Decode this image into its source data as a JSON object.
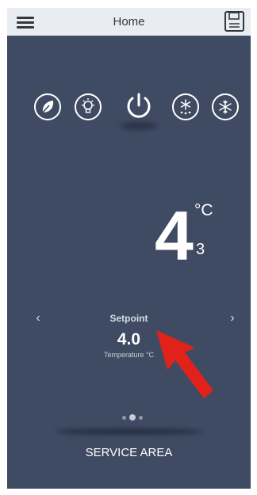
{
  "header": {
    "title": "Home",
    "menu_icon": "hamburger-icon",
    "save_icon": "floppy-disk-icon"
  },
  "modes": [
    {
      "name": "eco",
      "icon": "leaf-icon"
    },
    {
      "name": "light",
      "icon": "light-bulb-icon"
    },
    {
      "name": "power",
      "icon": "power-icon"
    },
    {
      "name": "defrost",
      "icon": "defrost-icon"
    },
    {
      "name": "freeze",
      "icon": "snowflake-icon"
    }
  ],
  "temperature": {
    "value": "4",
    "unit": "°C",
    "sub": "3"
  },
  "setpoint": {
    "label": "Setpoint",
    "value": "4.0",
    "caption": "Temperature °C",
    "prev": "‹",
    "next": "›"
  },
  "pager": {
    "count": 3,
    "active": 2
  },
  "footer": {
    "service_label": "SERVICE AREA"
  },
  "colors": {
    "background": "#3f4b63",
    "topbar": "#e9ecf1",
    "annotation_arrow": "#e0221b"
  }
}
